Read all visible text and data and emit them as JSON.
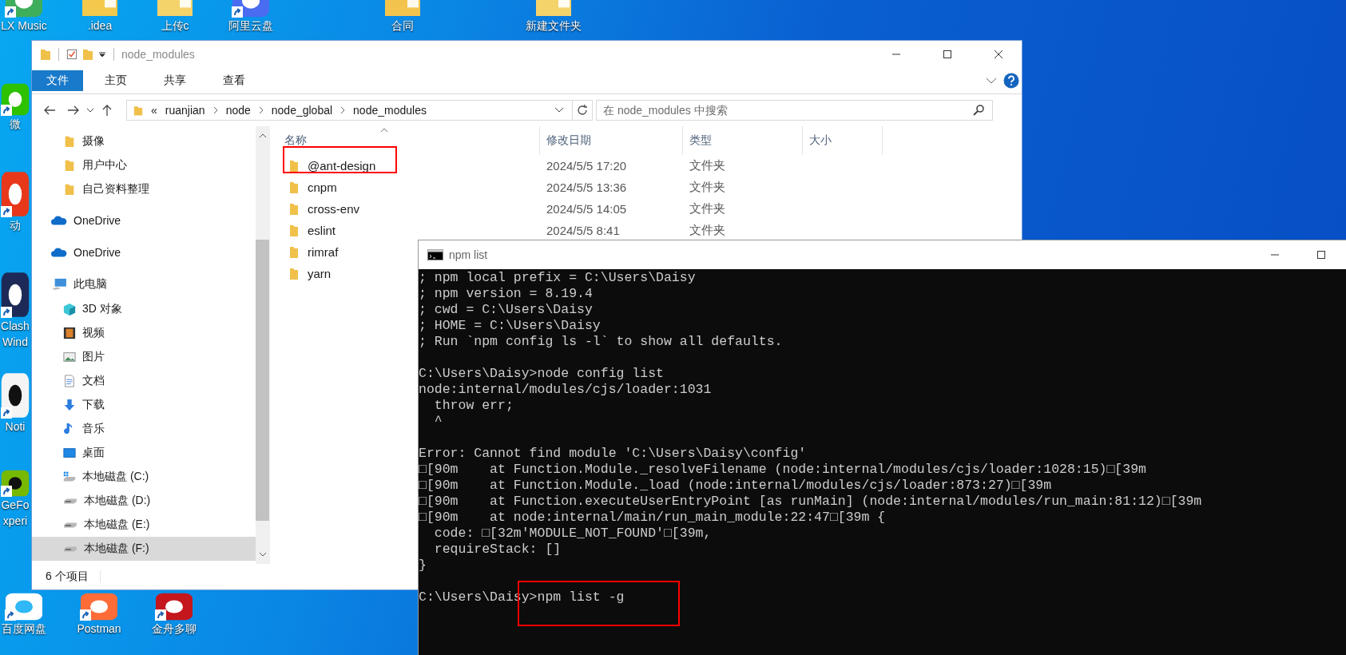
{
  "desktop_icons": [
    {
      "lines": [
        "LX Music"
      ],
      "kind": "app",
      "shortcut": true
    },
    {
      "lines": [
        ".idea"
      ],
      "kind": "folder",
      "shortcut": false
    },
    {
      "lines": [
        "上传c"
      ],
      "kind": "folder",
      "shortcut": false
    },
    {
      "lines": [
        "阿里云盘"
      ],
      "kind": "app",
      "shortcut": true
    },
    {
      "lines": [
        "合同"
      ],
      "kind": "folder",
      "shortcut": false
    },
    {
      "lines": [
        "新建文件夹"
      ],
      "kind": "folder",
      "shortcut": false
    },
    {
      "lines": [
        "微"
      ],
      "kind": "app",
      "shortcut": true
    },
    {
      "lines": [
        "动"
      ],
      "kind": "app",
      "shortcut": true
    },
    {
      "lines": [
        "Clash",
        "Wind"
      ],
      "kind": "app",
      "shortcut": true
    },
    {
      "lines": [
        "Noti"
      ],
      "kind": "app",
      "shortcut": true
    },
    {
      "lines": [
        "GeFo",
        "xperi"
      ],
      "kind": "app",
      "shortcut": true
    },
    {
      "lines": [
        "百度网盘"
      ],
      "kind": "app",
      "shortcut": true
    },
    {
      "lines": [
        "Postman"
      ],
      "kind": "app",
      "shortcut": true
    },
    {
      "lines": [
        "金舟多聊"
      ],
      "kind": "app",
      "shortcut": true
    }
  ],
  "explorer": {
    "title": "node_modules",
    "ribbon_tabs": [
      {
        "label": "文件",
        "selected": true
      },
      {
        "label": "主页",
        "selected": false
      },
      {
        "label": "共享",
        "selected": false
      },
      {
        "label": "查看",
        "selected": false
      }
    ],
    "address": {
      "overflow": "«",
      "crumbs": [
        "ruanjian",
        "node",
        "node_global",
        "node_modules"
      ]
    },
    "search": {
      "placeholder": "在 node_modules 中搜索"
    },
    "nav": [
      {
        "label": "摄像",
        "kind": "folder",
        "selected": false
      },
      {
        "label": "用户中心",
        "kind": "folder",
        "selected": false
      },
      {
        "label": "自己资料整理",
        "kind": "folder",
        "selected": false
      },
      {
        "label": "OneDrive",
        "kind": "cloud",
        "selected": false
      },
      {
        "label": "OneDrive",
        "kind": "cloud",
        "selected": false
      },
      {
        "label": "此电脑",
        "kind": "pc",
        "selected": false,
        "children": [
          {
            "label": "3D 对象",
            "kind": "cube",
            "selected": false
          },
          {
            "label": "视频",
            "kind": "video",
            "selected": false
          },
          {
            "label": "图片",
            "kind": "picture",
            "selected": false
          },
          {
            "label": "文档",
            "kind": "document",
            "selected": false
          },
          {
            "label": "下载",
            "kind": "download",
            "selected": false
          },
          {
            "label": "音乐",
            "kind": "music",
            "selected": false
          },
          {
            "label": "桌面",
            "kind": "desktop",
            "selected": false
          },
          {
            "label": "本地磁盘 (C:)",
            "kind": "system-drive",
            "selected": false
          },
          {
            "label": "本地磁盘 (D:)",
            "kind": "drive",
            "selected": false
          },
          {
            "label": "本地磁盘 (E:)",
            "kind": "drive",
            "selected": false
          },
          {
            "label": "本地磁盘 (F:)",
            "kind": "drive",
            "selected": true
          }
        ]
      }
    ],
    "columns": [
      "名称",
      "修改日期",
      "类型",
      "大小"
    ],
    "rows": [
      {
        "name": "@ant-design",
        "modified": "2024/5/5 17:20",
        "type": "文件夹",
        "highlighted": true
      },
      {
        "name": "cnpm",
        "modified": "2024/5/5 13:36",
        "type": "文件夹",
        "highlighted": false
      },
      {
        "name": "cross-env",
        "modified": "2024/5/5 14:05",
        "type": "文件夹",
        "highlighted": false
      },
      {
        "name": "eslint",
        "modified": "2024/5/5 8:41",
        "type": "文件夹",
        "highlighted": false
      },
      {
        "name": "rimraf",
        "highlighted": false
      },
      {
        "name": "yarn",
        "highlighted": false
      }
    ],
    "status": "6 个项目"
  },
  "terminal": {
    "title": "npm list",
    "lines": [
      {
        "kind": "output",
        "text": "; npm local prefix = C:\\Users\\Daisy"
      },
      {
        "kind": "output",
        "text": "; npm version = 8.19.4"
      },
      {
        "kind": "output",
        "text": "; cwd = C:\\Users\\Daisy"
      },
      {
        "kind": "output",
        "text": "; HOME = C:\\Users\\Daisy"
      },
      {
        "kind": "output",
        "text": "; Run `npm config ls -l` to show all defaults."
      },
      {
        "kind": "blank"
      },
      {
        "kind": "prompt",
        "prompt": "C:\\Users\\Daisy>",
        "command": "node config list",
        "highlighted": false
      },
      {
        "kind": "output",
        "text": "node:internal/modules/cjs/loader:1031"
      },
      {
        "kind": "output",
        "text": "  throw err;"
      },
      {
        "kind": "output",
        "text": "  ^"
      },
      {
        "kind": "blank"
      },
      {
        "kind": "output",
        "text": "Error: Cannot find module 'C:\\Users\\Daisy\\config'"
      },
      {
        "kind": "output",
        "text": "□[90m    at Function.Module._resolveFilename (node:internal/modules/cjs/loader:1028:15)□[39m"
      },
      {
        "kind": "output",
        "text": "□[90m    at Function.Module._load (node:internal/modules/cjs/loader:873:27)□[39m"
      },
      {
        "kind": "output",
        "text": "□[90m    at Function.executeUserEntryPoint [as runMain] (node:internal/modules/run_main:81:12)□[39m"
      },
      {
        "kind": "output",
        "text": "□[90m    at node:internal/main/run_main_module:22:47□[39m {"
      },
      {
        "kind": "output",
        "text": "  code: □[32m'MODULE_NOT_FOUND'□[39m,"
      },
      {
        "kind": "output",
        "text": "  requireStack: []"
      },
      {
        "kind": "output",
        "text": "}"
      },
      {
        "kind": "blank"
      },
      {
        "kind": "prompt",
        "prompt": "C:\\Users\\Daisy>",
        "command": "npm list -g",
        "highlighted": true
      }
    ]
  }
}
